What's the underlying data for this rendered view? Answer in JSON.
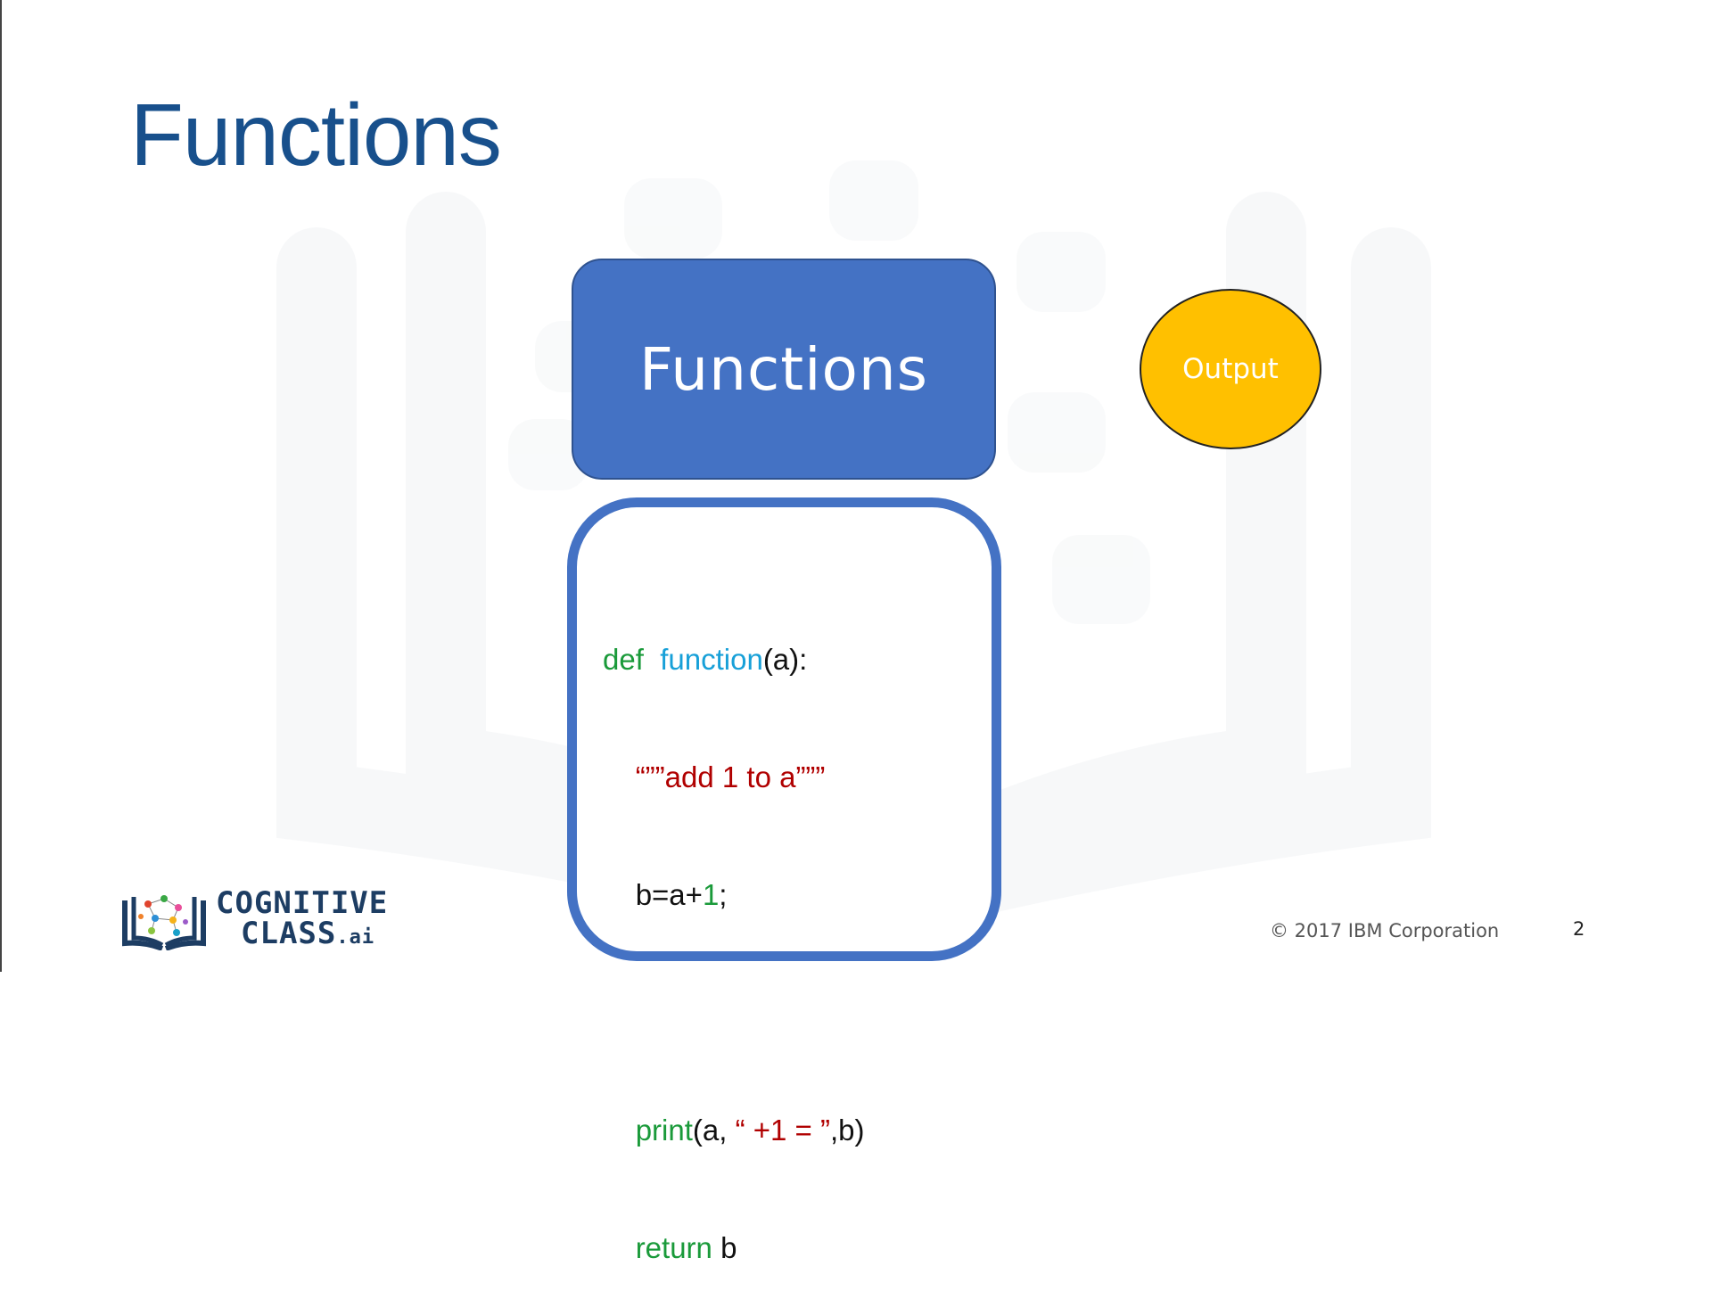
{
  "slide": {
    "title": "Functions",
    "page_number": "2",
    "copyright": "© 2017 IBM Corporation"
  },
  "diagram": {
    "function_box_label": "Functions",
    "output_label": "Output"
  },
  "code": {
    "line1_kw": "def",
    "line1_fn": "function",
    "line1_rest": "(a):",
    "line2_str": "“””add 1 to a”””",
    "line3_plain": "b=a+",
    "line3_num": "1",
    "line3_end": ";",
    "line5_kw": "print",
    "line5_a": "(a, ",
    "line5_str": "“ +1 = ”",
    "line5_end": ",b)",
    "line6_kw": "return",
    "line6_rest": " b"
  },
  "logo": {
    "line1": "COGNITIVE",
    "line2": "CLASS",
    "suffix": ".ai"
  },
  "colors": {
    "title": "#18508c",
    "box_fill": "#4472c4",
    "output_fill": "#ffc000",
    "keyword": "#1a9a3a",
    "function_name": "#17a0d8",
    "string": "#b00000"
  }
}
